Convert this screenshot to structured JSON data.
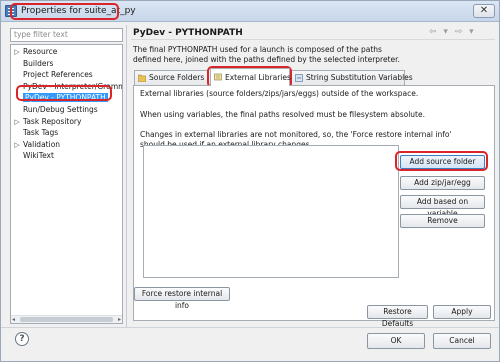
{
  "window": {
    "title": "Properties for suite_at_py",
    "close_label": "✕"
  },
  "left": {
    "filter_placeholder": "type filter text",
    "tree": [
      {
        "label": "Resource",
        "arrow": "▷"
      },
      {
        "label": "Builders",
        "arrow": ""
      },
      {
        "label": "Project References",
        "arrow": ""
      },
      {
        "label": "PyDev - Interpreter/Gramm",
        "arrow": ""
      },
      {
        "label": "PyDev - PYTHONPATH",
        "arrow": "",
        "selected": true
      },
      {
        "label": "Run/Debug Settings",
        "arrow": ""
      },
      {
        "label": "Task Repository",
        "arrow": "▷"
      },
      {
        "label": "Task Tags",
        "arrow": ""
      },
      {
        "label": "Validation",
        "arrow": "▷"
      },
      {
        "label": "WikiText",
        "arrow": ""
      }
    ]
  },
  "page": {
    "title": "PyDev - PYTHONPATH",
    "nav_arrows": "⇦ ▾ ⇨ ▾",
    "description_line1": "The final PYTHONPATH used for a launch is composed of the paths",
    "description_line2": "defined here, joined with the paths defined by the selected interpreter.",
    "tabs": [
      {
        "label": "Source Folders"
      },
      {
        "label": "External Libraries",
        "active": true
      },
      {
        "label": "String Substitution Variables"
      }
    ],
    "panel": {
      "line1": "External libraries (source folders/zips/jars/eggs) outside of the workspace.",
      "line2": "When using variables, the final paths resolved must be filesystem absolute.",
      "line3": "Changes in external libraries are not monitored, so, the 'Force restore internal info'",
      "line4": "should be used if an external library changes."
    },
    "buttons": {
      "add_source_folder": "Add source folder",
      "add_zip": "Add zip/jar/egg",
      "add_based_on_variable": "Add based on variable",
      "remove": "Remove",
      "force_restore": "Force restore internal info",
      "restore_defaults": "Restore Defaults",
      "apply": "Apply"
    }
  },
  "footer": {
    "help": "?",
    "ok": "OK",
    "cancel": "Cancel"
  },
  "colors": {
    "highlight": "#d9262b",
    "selection": "#3399ff"
  }
}
